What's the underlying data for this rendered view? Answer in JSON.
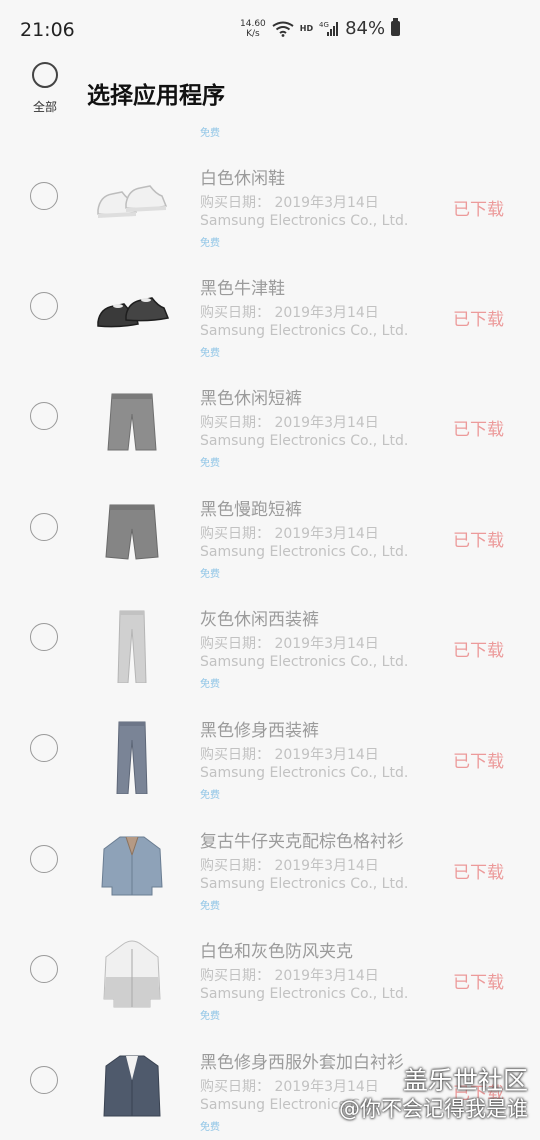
{
  "status_bar": {
    "time": "21:06",
    "net_speed_value": "14.60",
    "net_speed_unit": "K/s",
    "hd": "HD",
    "network": "4G",
    "battery": "84%"
  },
  "header": {
    "select_all_label": "全部",
    "title": "选择应用程序"
  },
  "partial_item_price": "免费",
  "items": [
    {
      "name": "白色休闲鞋",
      "date": "购买日期： 2019年3月14日",
      "developer": "Samsung Electronics Co., Ltd.",
      "price": "免费",
      "status": "已下载",
      "icon": "white-sneaker-icon"
    },
    {
      "name": "黑色牛津鞋",
      "date": "购买日期： 2019年3月14日",
      "developer": "Samsung Electronics Co., Ltd.",
      "price": "免费",
      "status": "已下载",
      "icon": "black-oxford-shoe-icon"
    },
    {
      "name": "黑色休闲短裤",
      "date": "购买日期： 2019年3月14日",
      "developer": "Samsung Electronics Co., Ltd.",
      "price": "免费",
      "status": "已下载",
      "icon": "black-casual-shorts-icon"
    },
    {
      "name": "黑色慢跑短裤",
      "date": "购买日期： 2019年3月14日",
      "developer": "Samsung Electronics Co., Ltd.",
      "price": "免费",
      "status": "已下载",
      "icon": "black-jogging-shorts-icon"
    },
    {
      "name": "灰色休闲西装裤",
      "date": "购买日期： 2019年3月14日",
      "developer": "Samsung Electronics Co., Ltd.",
      "price": "免费",
      "status": "已下载",
      "icon": "gray-trousers-icon"
    },
    {
      "name": "黑色修身西装裤",
      "date": "购买日期： 2019年3月14日",
      "developer": "Samsung Electronics Co., Ltd.",
      "price": "免费",
      "status": "已下载",
      "icon": "slim-trousers-icon"
    },
    {
      "name": "复古牛仔夹克配棕色格衬衫",
      "date": "购买日期： 2019年3月14日",
      "developer": "Samsung Electronics Co., Ltd.",
      "price": "免费",
      "status": "已下载",
      "icon": "denim-jacket-icon"
    },
    {
      "name": "白色和灰色防风夹克",
      "date": "购买日期： 2019年3月14日",
      "developer": "Samsung Electronics Co., Ltd.",
      "price": "免费",
      "status": "已下载",
      "icon": "windbreaker-icon"
    },
    {
      "name": "黑色修身西服外套加白衬衫",
      "date": "购买日期： 2019年3月14日",
      "developer": "Samsung Electronics Co., Ltd.",
      "price": "免费",
      "status": "已下载",
      "icon": "suit-jacket-icon"
    }
  ],
  "watermark": {
    "brand": "盖乐世社区",
    "user": "@你不会记得我是谁"
  },
  "colors": {
    "background": "#f7f7f7",
    "status_downloaded": "#ec9a9a",
    "price_free": "#8ec4e6",
    "item_name": "#9b9b9b"
  }
}
